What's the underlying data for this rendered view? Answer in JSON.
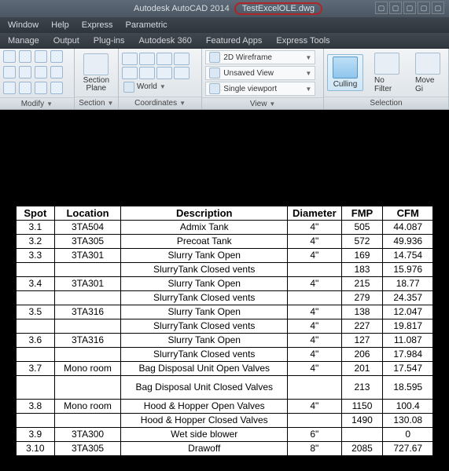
{
  "title": {
    "app": "Autodesk AutoCAD 2014",
    "doc": "TestExcelOLE.dwg"
  },
  "quick_access": [
    "q1",
    "q2",
    "q3",
    "q4",
    "q5"
  ],
  "menubar": [
    "Window",
    "Help",
    "Express",
    "Parametric"
  ],
  "tabbar": [
    "Manage",
    "Output",
    "Plug-ins",
    "Autodesk 360",
    "Featured Apps",
    "Express Tools"
  ],
  "ribbon": {
    "modify": {
      "title": "Modify"
    },
    "section": {
      "title": "Section",
      "btn": "Section Plane"
    },
    "coordinates": {
      "title": "Coordinates",
      "world": "World"
    },
    "view": {
      "title": "View",
      "rows": [
        {
          "icon": "wireframe-icon",
          "label": "2D Wireframe"
        },
        {
          "icon": "unsaved-icon",
          "label": "Unsaved View"
        },
        {
          "icon": "viewport-icon",
          "label": "Single viewport"
        }
      ]
    },
    "selection": {
      "title": "Selection",
      "culling": "Culling",
      "nofilter": "No Filter",
      "movegizmo": "Move Gi"
    }
  },
  "chart_data": {
    "type": "table",
    "columns": [
      "Spot",
      "Location",
      "Description",
      "Diameter",
      "FMP",
      "CFM"
    ],
    "rows": [
      {
        "spot": "3.1",
        "location": "3TA504",
        "description": "Admix Tank",
        "diameter": "4\"",
        "fmp": "505",
        "cfm": "44.087"
      },
      {
        "spot": "3.2",
        "location": "3TA305",
        "description": "Precoat Tank",
        "diameter": "4\"",
        "fmp": "572",
        "cfm": "49.936"
      },
      {
        "spot": "3.3",
        "location": "3TA301",
        "description": "Slurry Tank Open",
        "diameter": "4\"",
        "fmp": "169",
        "cfm": "14.754"
      },
      {
        "spot": "",
        "location": "",
        "description": "SlurryTank Closed vents",
        "diameter": "",
        "fmp": "183",
        "cfm": "15.976"
      },
      {
        "spot": "3.4",
        "location": "3TA301",
        "description": "Slurry Tank Open",
        "diameter": "4\"",
        "fmp": "215",
        "cfm": "18.77"
      },
      {
        "spot": "",
        "location": "",
        "description": "SlurryTank Closed vents",
        "diameter": "",
        "fmp": "279",
        "cfm": "24.357"
      },
      {
        "spot": "3.5",
        "location": "3TA316",
        "description": "Slurry Tank Open",
        "diameter": "4\"",
        "fmp": "138",
        "cfm": "12.047"
      },
      {
        "spot": "",
        "location": "",
        "description": "SlurryTank Closed vents",
        "diameter": "4\"",
        "fmp": "227",
        "cfm": "19.817"
      },
      {
        "spot": "3.6",
        "location": "3TA316",
        "description": "Slurry Tank Open",
        "diameter": "4\"",
        "fmp": "127",
        "cfm": "11.087"
      },
      {
        "spot": "",
        "location": "",
        "description": "SlurryTank Closed vents",
        "diameter": "4\"",
        "fmp": "206",
        "cfm": "17.984"
      },
      {
        "spot": "3.7",
        "location": "Mono room",
        "description": "Bag Disposal Unit Open Valves",
        "diameter": "4\"",
        "fmp": "201",
        "cfm": "17.547"
      },
      {
        "spot": "",
        "location": "",
        "description": "Bag Disposal Unit Closed Valves",
        "diameter": "",
        "fmp": "213",
        "cfm": "18.595"
      },
      {
        "spot": "3.8",
        "location": "Mono room",
        "description": "Hood & Hopper Open Valves",
        "diameter": "4\"",
        "fmp": "1150",
        "cfm": "100.4"
      },
      {
        "spot": "",
        "location": "",
        "description": "Hood & Hopper Closed Valves",
        "diameter": "",
        "fmp": "1490",
        "cfm": "130.08"
      },
      {
        "spot": "3.9",
        "location": "3TA300",
        "description": "Wet side blower",
        "diameter": "6\"",
        "fmp": "",
        "cfm": "0"
      },
      {
        "spot": "3.10",
        "location": "3TA305",
        "description": "Drawoff",
        "diameter": "8\"",
        "fmp": "2085",
        "cfm": "727.67"
      }
    ]
  }
}
